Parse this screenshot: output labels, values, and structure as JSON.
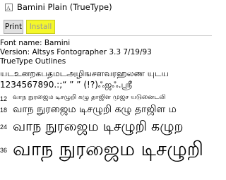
{
  "window": {
    "title": "Bamini Plain (TrueType)",
    "icon": "font-file-icon"
  },
  "toolbar": {
    "print_label": "Print",
    "install_label": "Install"
  },
  "font_info": {
    "name_line": "Font name: Bamini",
    "version_line": "Version: Altsys Fontographer 3.3  7/19/93",
    "type_line": "TrueType Outlines"
  },
  "samples": {
    "alphabet_line": "யடஉனறகபதமடஅழிஙசளவரஹலண யுடய",
    "digits_line": "1234567890.:;“ ” ” (!?)ஃஜஃ.ஸ்ரீ"
  },
  "size_samples": [
    {
      "size": "12",
      "text": "வாந நுரஜைம டிசழுறி கழு தாஜிள முஜச யடுனைடலி"
    },
    {
      "size": "18",
      "text": "வாந நுரஜைம டிசழுறி கழு தாஜிள ம"
    },
    {
      "size": "24",
      "text": "வாந நுரஜைம டிசழுறி கழுற"
    },
    {
      "size": "36",
      "text": "வாந நுரஜைம டிசழுறி"
    }
  ]
}
